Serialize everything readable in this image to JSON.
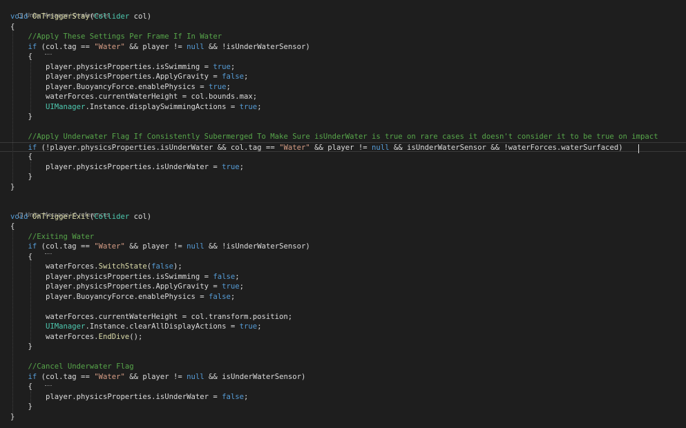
{
  "editor": {
    "colors": {
      "background": "#1e1e1e",
      "keyword": "#569cd6",
      "type": "#4ec9b0",
      "comment": "#57a64a",
      "string": "#d69d85",
      "method": "#dcdcaa",
      "plain": "#dcdcdc"
    },
    "code_lenses": [
      {
        "label": "Unity Message",
        "refs": "0 references",
        "icon": "unity-cube-icon"
      },
      {
        "label": "Unity Message",
        "refs": "0 references",
        "icon": "unity-cube-icon"
      }
    ],
    "lines": [
      [
        [
          "kw",
          "void "
        ],
        [
          "fn",
          "OnTriggerStay"
        ],
        [
          "pl",
          "("
        ],
        [
          "ty",
          "Collider"
        ],
        [
          "pl",
          " col)"
        ]
      ],
      [
        [
          "br",
          "{"
        ]
      ],
      [
        [
          "pl",
          "    "
        ],
        [
          "cm",
          "//Apply These Settings Per Frame If In Water"
        ]
      ],
      [
        [
          "pl",
          "    "
        ],
        [
          "kw",
          "if"
        ],
        [
          "pl",
          " (col.tag == "
        ],
        [
          "st",
          "\"Water\""
        ],
        [
          "pl",
          " && player != "
        ],
        [
          "kw",
          "null"
        ],
        [
          "pl",
          " && !isUnderWaterSensor)"
        ]
      ],
      [
        [
          "pl",
          "    {"
        ]
      ],
      [
        [
          "pl",
          "        player.physicsProperties.isSwimming = "
        ],
        [
          "kw",
          "true"
        ],
        [
          "pl",
          ";"
        ]
      ],
      [
        [
          "pl",
          "        player.physicsProperties.ApplyGravity = "
        ],
        [
          "kw",
          "false"
        ],
        [
          "pl",
          ";"
        ]
      ],
      [
        [
          "pl",
          "        player.BuoyancyForce.enablePhysics = "
        ],
        [
          "kw",
          "true"
        ],
        [
          "pl",
          ";"
        ]
      ],
      [
        [
          "pl",
          "        waterForces.currentWaterHeight = col.bounds.max;"
        ]
      ],
      [
        [
          "pl",
          "        "
        ],
        [
          "ty",
          "UIManager"
        ],
        [
          "pl",
          ".Instance.displaySwimmingActions = "
        ],
        [
          "kw",
          "true"
        ],
        [
          "pl",
          ";"
        ]
      ],
      [
        [
          "pl",
          "    }"
        ]
      ],
      [
        [
          "pl",
          ""
        ]
      ],
      [
        [
          "pl",
          "    "
        ],
        [
          "cm",
          "//Apply Underwater Flag If Consistently Subermerged To Make Sure isUnderWater is true on rare cases it doesn't consider it to be true on impact"
        ]
      ],
      [
        [
          "pl",
          "    "
        ],
        [
          "kw",
          "if"
        ],
        [
          "pl",
          " (!player.physicsProperties.isUnderWater && col.tag == "
        ],
        [
          "st",
          "\"Water\""
        ],
        [
          "pl",
          " && player != "
        ],
        [
          "kw",
          "null"
        ],
        [
          "pl",
          " && isUnderWaterSensor && !waterForces.waterSurfaced)"
        ]
      ],
      [
        [
          "pl",
          "    {"
        ]
      ],
      [
        [
          "pl",
          "        player.physicsProperties.isUnderWater = "
        ],
        [
          "kw",
          "true"
        ],
        [
          "pl",
          ";"
        ]
      ],
      [
        [
          "pl",
          "    }"
        ]
      ],
      [
        [
          "br",
          "}"
        ]
      ],
      [
        [
          "pl",
          ""
        ]
      ],
      [
        [
          "kw",
          "void "
        ],
        [
          "fn",
          "OnTriggerExit"
        ],
        [
          "pl",
          "("
        ],
        [
          "ty",
          "Collider"
        ],
        [
          "pl",
          " col)"
        ]
      ],
      [
        [
          "br",
          "{"
        ]
      ],
      [
        [
          "pl",
          "    "
        ],
        [
          "cm",
          "//Exiting Water"
        ]
      ],
      [
        [
          "pl",
          "    "
        ],
        [
          "kw",
          "if"
        ],
        [
          "pl",
          " (col.tag == "
        ],
        [
          "st",
          "\"Water\""
        ],
        [
          "pl",
          " && player != "
        ],
        [
          "kw",
          "null"
        ],
        [
          "pl",
          " && !isUnderWaterSensor)"
        ]
      ],
      [
        [
          "pl",
          "    {"
        ]
      ],
      [
        [
          "pl",
          "        waterForces."
        ],
        [
          "fn",
          "SwitchState"
        ],
        [
          "pl",
          "("
        ],
        [
          "kw",
          "false"
        ],
        [
          "pl",
          ");"
        ]
      ],
      [
        [
          "pl",
          "        player.physicsProperties.isSwimming = "
        ],
        [
          "kw",
          "false"
        ],
        [
          "pl",
          ";"
        ]
      ],
      [
        [
          "pl",
          "        player.physicsProperties.ApplyGravity = "
        ],
        [
          "kw",
          "true"
        ],
        [
          "pl",
          ";"
        ]
      ],
      [
        [
          "pl",
          "        player.BuoyancyForce.enablePhysics = "
        ],
        [
          "kw",
          "false"
        ],
        [
          "pl",
          ";"
        ]
      ],
      [
        [
          "pl",
          ""
        ]
      ],
      [
        [
          "pl",
          "        waterForces.currentWaterHeight = col.transform.position;"
        ]
      ],
      [
        [
          "pl",
          "        "
        ],
        [
          "ty",
          "UIManager"
        ],
        [
          "pl",
          ".Instance.clearAllDisplayActions = "
        ],
        [
          "kw",
          "true"
        ],
        [
          "pl",
          ";"
        ]
      ],
      [
        [
          "pl",
          "        waterForces."
        ],
        [
          "fn",
          "EndDive"
        ],
        [
          "pl",
          "();"
        ]
      ],
      [
        [
          "pl",
          "    }"
        ]
      ],
      [
        [
          "pl",
          ""
        ]
      ],
      [
        [
          "pl",
          "    "
        ],
        [
          "cm",
          "//Cancel Underwater Flag"
        ]
      ],
      [
        [
          "pl",
          "    "
        ],
        [
          "kw",
          "if"
        ],
        [
          "pl",
          " (col.tag == "
        ],
        [
          "st",
          "\"Water\""
        ],
        [
          "pl",
          " && player != "
        ],
        [
          "kw",
          "null"
        ],
        [
          "pl",
          " && isUnderWaterSensor)"
        ]
      ],
      [
        [
          "pl",
          "    {"
        ]
      ],
      [
        [
          "pl",
          "        player.physicsProperties.isUnderWater = "
        ],
        [
          "kw",
          "false"
        ],
        [
          "pl",
          ";"
        ]
      ],
      [
        [
          "pl",
          "    }"
        ]
      ],
      [
        [
          "br",
          "}"
        ]
      ]
    ]
  }
}
